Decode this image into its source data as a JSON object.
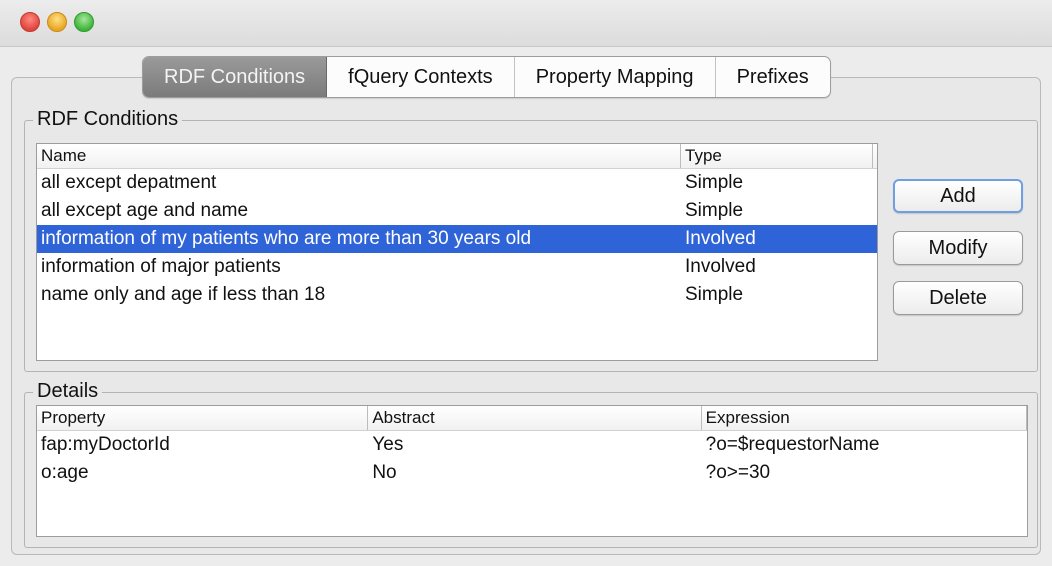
{
  "tabs": [
    {
      "label": "RDF Conditions",
      "selected": true
    },
    {
      "label": "fQuery Contexts",
      "selected": false
    },
    {
      "label": "Property Mapping",
      "selected": false
    },
    {
      "label": "Prefixes",
      "selected": false
    }
  ],
  "rdf_conditions": {
    "title": "RDF Conditions",
    "columns": [
      "Name",
      "Type"
    ],
    "rows": [
      {
        "name": "all except depatment",
        "type": "Simple"
      },
      {
        "name": "all except age and name",
        "type": "Simple"
      },
      {
        "name": "information of my patients who are more than 30 years old",
        "type": "Involved"
      },
      {
        "name": "information of major patients",
        "type": "Involved"
      },
      {
        "name": "name only and age if less than 18",
        "type": "Simple"
      }
    ],
    "selected_row": 2,
    "buttons": {
      "add": "Add",
      "modify": "Modify",
      "delete": "Delete"
    }
  },
  "details": {
    "title": "Details",
    "columns": [
      "Property",
      "Abstract",
      "Expression"
    ],
    "rows": [
      {
        "property": "fap:myDoctorId",
        "abstract": "Yes",
        "expression": "?o=$requestorName"
      },
      {
        "property": "o:age",
        "abstract": "No",
        "expression": "?o>=30"
      }
    ]
  },
  "colors": {
    "selection": "#2f63d8",
    "selected_tab": "#8a8a8a",
    "close_button": "#e0443e",
    "minimize_button": "#e8a622",
    "zoom_button": "#3fb43a"
  }
}
